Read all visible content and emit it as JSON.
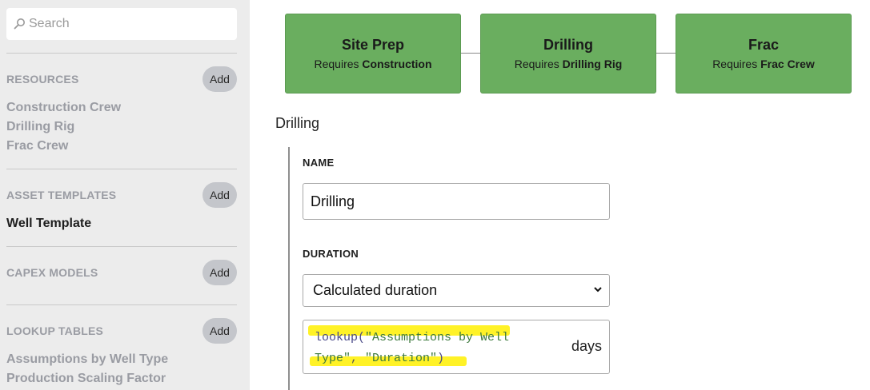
{
  "sidebar": {
    "search_placeholder": "Search",
    "sections": {
      "resources": {
        "title": "RESOURCES",
        "add_label": "Add",
        "items": [
          "Construction Crew",
          "Drilling Rig",
          "Frac Crew"
        ]
      },
      "asset_templates": {
        "title": "ASSET TEMPLATES",
        "add_label": "Add",
        "items": [
          "Well Template"
        ]
      },
      "capex_models": {
        "title": "CAPEX MODELS",
        "add_label": "Add",
        "items": []
      },
      "lookup_tables": {
        "title": "LOOKUP TABLES",
        "add_label": "Add",
        "items": [
          "Assumptions by Well Type",
          "Production Scaling Factor"
        ]
      }
    }
  },
  "flow": {
    "requires_prefix": "Requires ",
    "steps": [
      {
        "title": "Site Prep",
        "requires": "Construction"
      },
      {
        "title": "Drilling",
        "requires": "Drilling Rig"
      },
      {
        "title": "Frac",
        "requires": "Frac Crew"
      }
    ]
  },
  "detail": {
    "title": "Drilling",
    "name_label": "NAME",
    "name_value": "Drilling",
    "duration_label": "DURATION",
    "duration_option": "Calculated duration",
    "formula": {
      "fn": "lookup(",
      "arg1_a": "\"Assumptions by Well",
      "arg1_b": "Type\"",
      "sep": ", ",
      "arg2": "\"Duration\"",
      "close": ")"
    },
    "unit": "days"
  },
  "colors": {
    "step_green": "#6aae5f",
    "highlight": "#fff227",
    "sidebar_bg": "#ececec"
  }
}
